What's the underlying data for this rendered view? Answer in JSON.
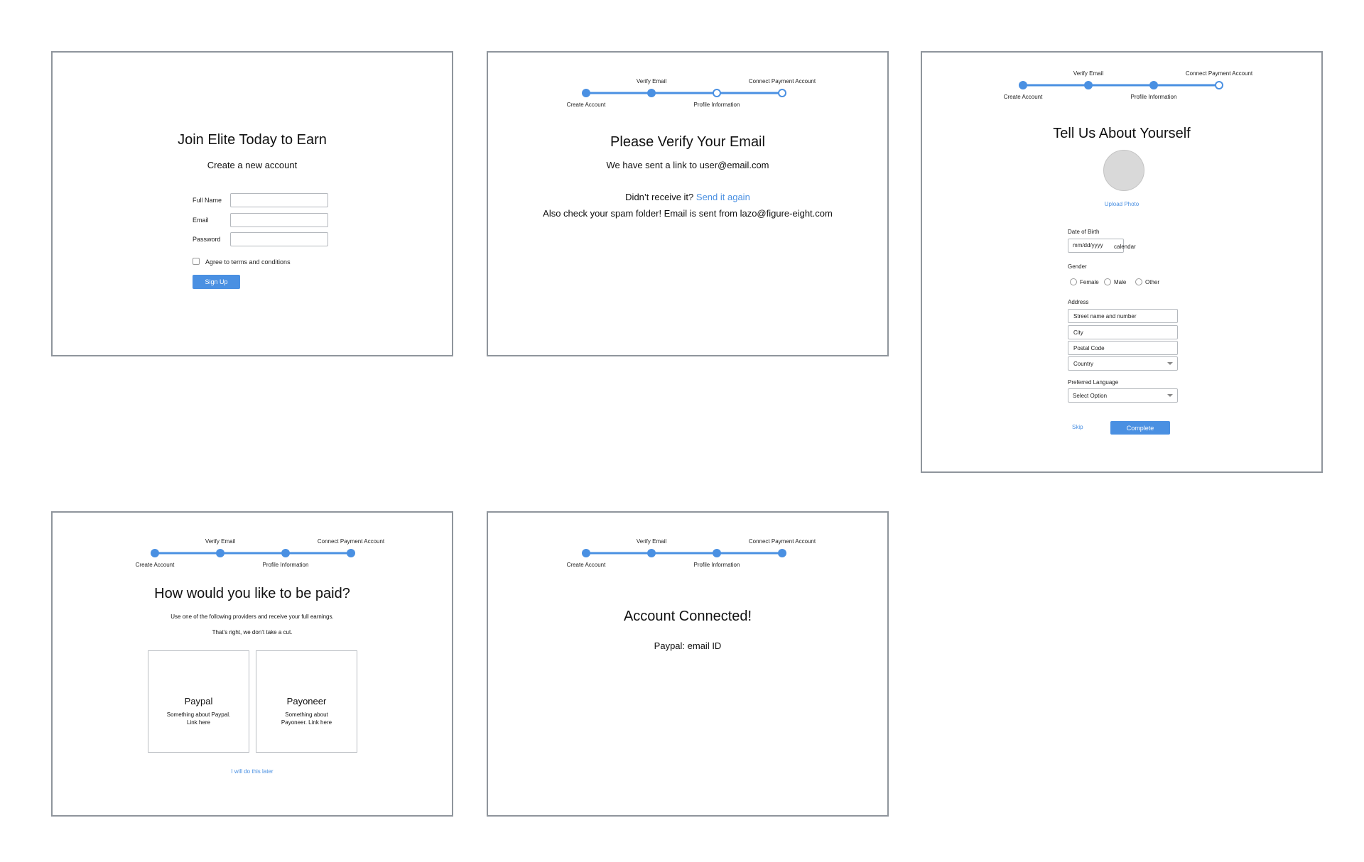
{
  "stepper": {
    "labels": [
      "Create Account",
      "Verify Email",
      "Profile Information",
      "Connect Payment Account"
    ]
  },
  "screen1": {
    "title": "Join Elite Today to Earn",
    "subtitle": "Create a new account",
    "full_name_label": "Full Name",
    "email_label": "Email",
    "password_label": "Password",
    "terms_label": "Agree to terms and conditions",
    "signup_button": "Sign Up"
  },
  "screen2": {
    "title": "Please Verify Your Email",
    "sent_text": "We have sent a link to user@email.com",
    "not_received": "Didn’t receive it?",
    "send_again": "Send it again",
    "spam_note": "Also check your spam folder! Email is sent from lazo@figure-eight.com"
  },
  "screen3": {
    "title": "Tell Us About Yourself",
    "upload_photo": "Upload Photo",
    "dob_label": "Date of Birth",
    "dob_placeholder": "mm/dd/yyyy",
    "calendar_label": "calendar",
    "gender_label": "Gender",
    "gender_options": [
      "Female",
      "Male",
      "Other"
    ],
    "address_label": "Address",
    "street_placeholder": "Street name and number",
    "city_placeholder": "City",
    "postal_placeholder": "Postal Code",
    "country_select": "Country",
    "language_label": "Preferred Language",
    "language_select": "Select Option",
    "skip_link": "Skip",
    "complete_button": "Complete"
  },
  "screen4": {
    "title": "How would you like to be paid?",
    "line1": "Use one of the following providers and receive your full earnings.",
    "line2": "That’s right, we don’t take a cut.",
    "paypal_title": "Paypal",
    "paypal_desc": "Something about Paypal. Link here",
    "payoneer_title": "Payoneer",
    "payoneer_desc": "Something about Payoneer. Link here",
    "later_link": "I will do this later"
  },
  "screen5": {
    "title": "Account Connected!",
    "detail": "Paypal: email ID"
  },
  "colors": {
    "accent": "#4a90e2",
    "frame_border": "#8f959c"
  }
}
